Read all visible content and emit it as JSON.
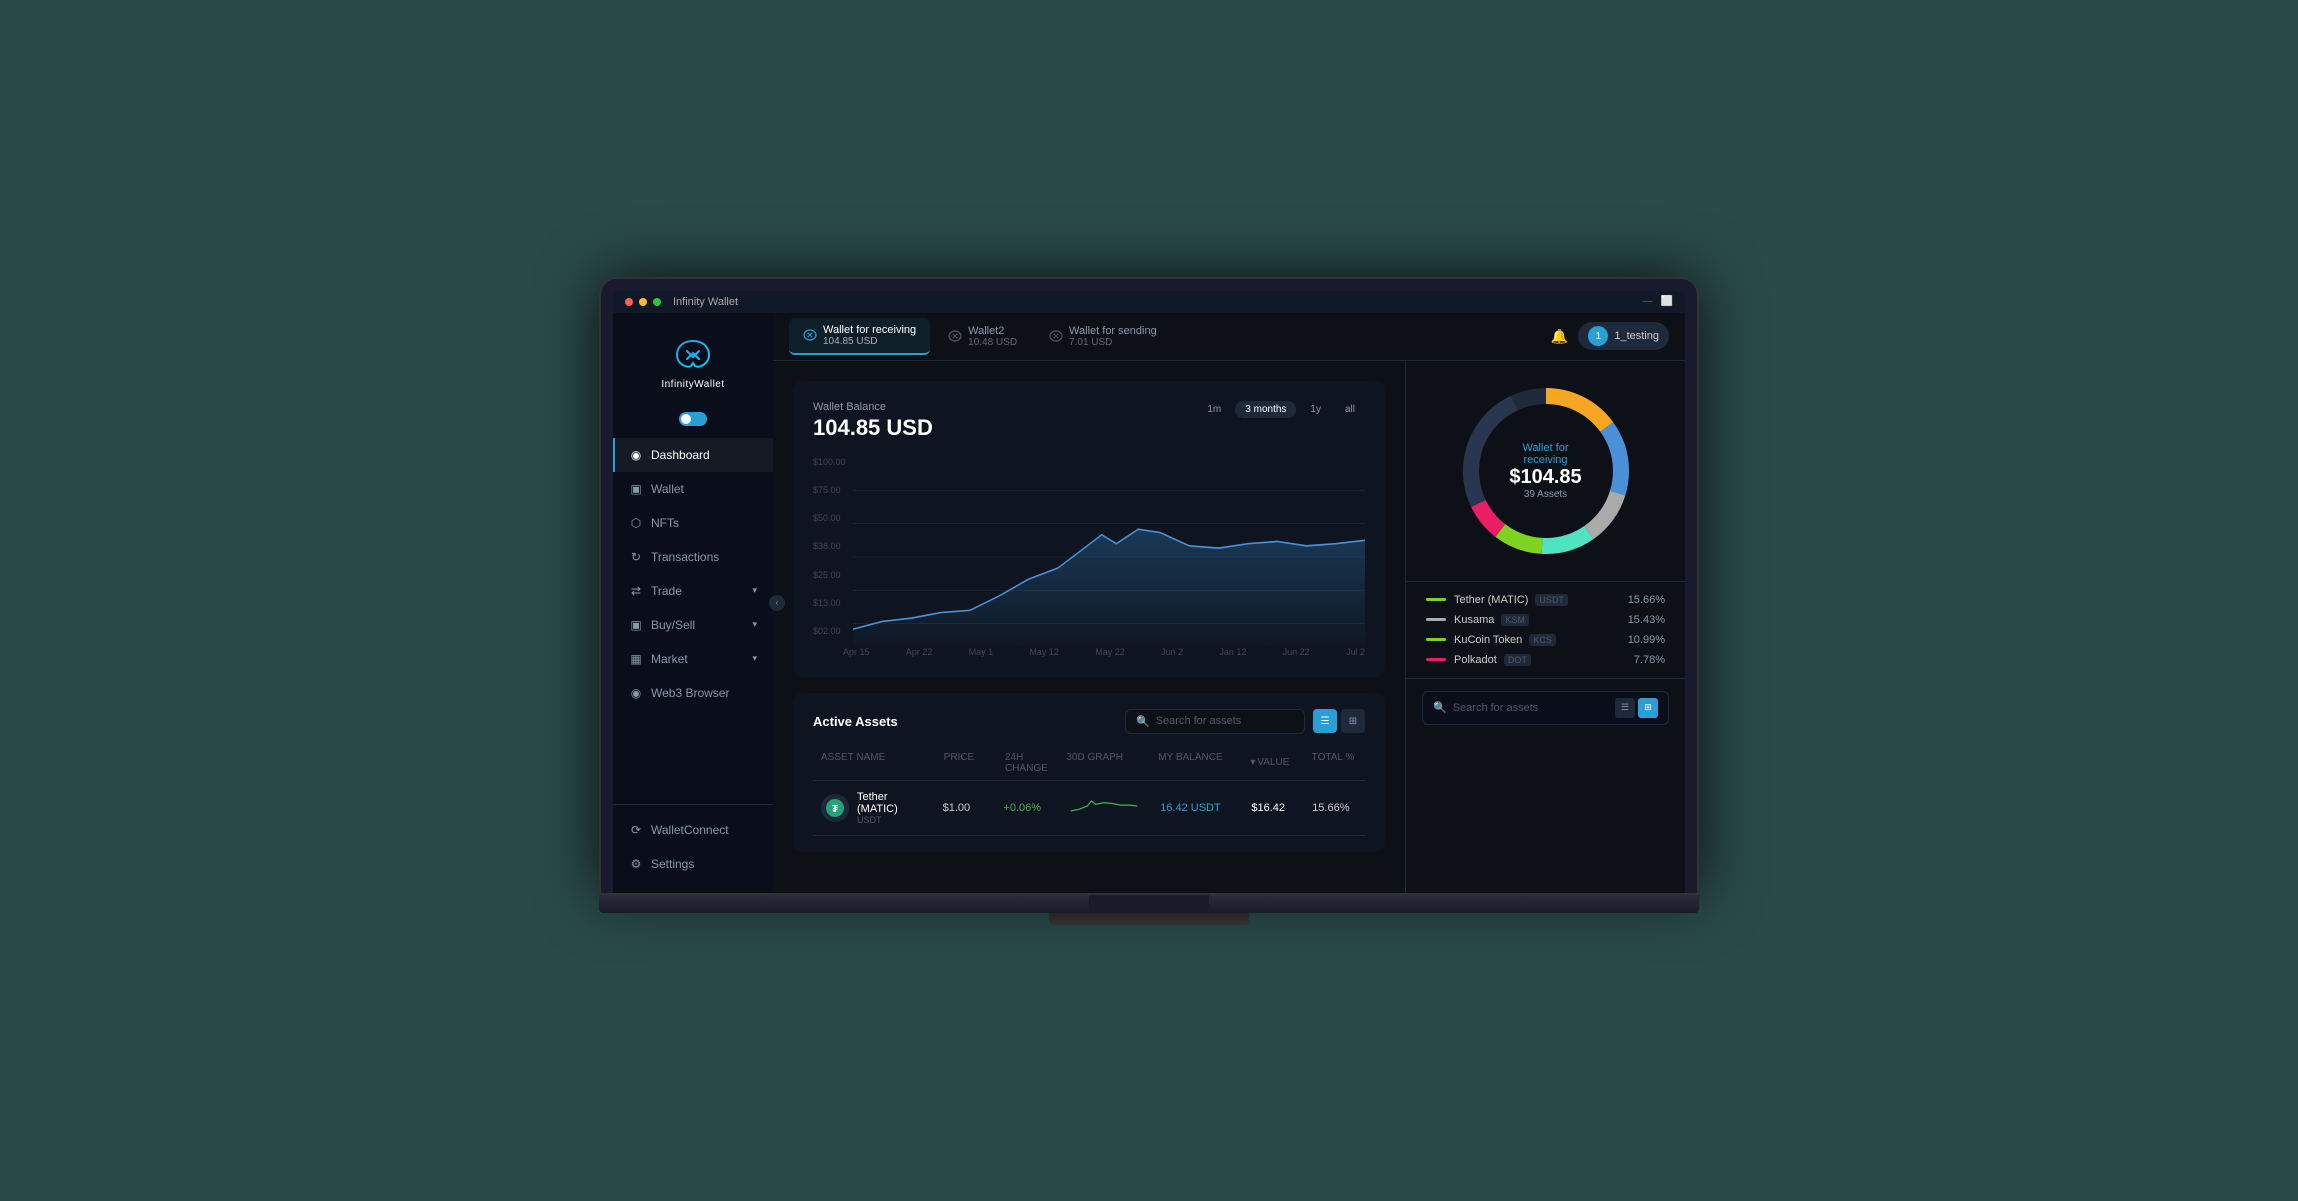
{
  "app": {
    "title": "Infinity Wallet",
    "titleBarText": "Infinity Wallet"
  },
  "header": {
    "tabs": [
      {
        "id": "tab1",
        "name": "Wallet for receiving",
        "amount": "104.85 USD",
        "active": true
      },
      {
        "id": "tab2",
        "name": "Wallet2",
        "amount": "10.48 USD",
        "active": false
      },
      {
        "id": "tab3",
        "name": "Wallet for sending",
        "amount": "7.01 USD",
        "active": false
      }
    ],
    "notification_icon": "🔔",
    "user": "1_testing"
  },
  "sidebar": {
    "logo_text": "InfinityWallet",
    "nav_items": [
      {
        "id": "dashboard",
        "label": "Dashboard",
        "icon": "◉",
        "active": true
      },
      {
        "id": "wallet",
        "label": "Wallet",
        "icon": "◫",
        "active": false
      },
      {
        "id": "nfts",
        "label": "NFTs",
        "icon": "⬡",
        "active": false
      },
      {
        "id": "transactions",
        "label": "Transactions",
        "icon": "↻",
        "active": false
      },
      {
        "id": "trade",
        "label": "Trade",
        "icon": "⇄",
        "active": false,
        "hasArrow": true
      },
      {
        "id": "buysell",
        "label": "Buy/Sell",
        "icon": "◫",
        "active": false,
        "hasArrow": true
      },
      {
        "id": "market",
        "label": "Market",
        "icon": "📊",
        "active": false,
        "hasArrow": true
      },
      {
        "id": "web3browser",
        "label": "Web3 Browser",
        "icon": "◉",
        "active": false
      }
    ],
    "bottom_items": [
      {
        "id": "walletconnect",
        "label": "WalletConnect",
        "icon": "◉"
      },
      {
        "id": "settings",
        "label": "Settings",
        "icon": "⚙"
      }
    ]
  },
  "chart": {
    "balance_label": "Wallet Balance",
    "balance_value": "104.85 USD",
    "time_filters": [
      {
        "id": "1m",
        "label": "1m",
        "active": false
      },
      {
        "id": "3months",
        "label": "3 months",
        "active": true
      },
      {
        "id": "1y",
        "label": "1y",
        "active": false
      },
      {
        "id": "all",
        "label": "all",
        "active": false
      }
    ],
    "y_labels": [
      "$02.00",
      "$13.00",
      "$25.00",
      "$38.00",
      "$50.00",
      "$75.00",
      "$100.00"
    ],
    "x_labels": [
      "Apr 15",
      "Apr 22",
      "May 1",
      "May 12",
      "May 22",
      "Jun 2",
      "Jan 12",
      "Jun 22",
      "Jul 2"
    ]
  },
  "donut": {
    "wallet_name": "Wallet for receiving",
    "amount": "$104.85",
    "assets_count": "39 Assets",
    "segments": [
      {
        "color": "#f5a623",
        "pct": 15.66,
        "offset": 0
      },
      {
        "color": "#4a90d9",
        "pct": 15.43,
        "offset": 15.66
      },
      {
        "color": "#aaa",
        "pct": 10.99,
        "offset": 31.09
      },
      {
        "color": "#50e3c2",
        "pct": 10.99,
        "offset": 42.08
      },
      {
        "color": "#7ed321",
        "pct": 10,
        "offset": 53.07
      },
      {
        "color": "#e91e63",
        "pct": 7.78,
        "offset": 63.07
      },
      {
        "color": "#556",
        "pct": 26.27,
        "offset": 70.85
      }
    ],
    "legend": [
      {
        "name": "Tether (MATIC)",
        "ticker": "USDT",
        "color": "#7ed321",
        "pct": "15.66%"
      },
      {
        "name": "Kusama",
        "ticker": "KSM",
        "color": "#aaa",
        "pct": "15.43%"
      },
      {
        "name": "KuCoin Token",
        "ticker": "KCS",
        "color": "#7ed321",
        "pct": "10.99%"
      },
      {
        "name": "Polkadot",
        "ticker": "DOT",
        "color": "#e91e63",
        "pct": "7.78%"
      }
    ]
  },
  "active_assets": {
    "title": "Active Assets",
    "search_placeholder": "Search for assets",
    "columns": [
      "ASSET NAME",
      "PRICE",
      "24H CHANGE",
      "30D GRAPH",
      "MY BALANCE",
      "VALUE",
      "TOTAL %"
    ],
    "rows": [
      {
        "name": "Tether (MATIC)",
        "ticker": "USDT",
        "price": "$1.00",
        "change": "+0.06%",
        "change_positive": true,
        "balance": "16.42 USDT",
        "value": "$16.42",
        "total_pct": "15.66%"
      }
    ]
  }
}
